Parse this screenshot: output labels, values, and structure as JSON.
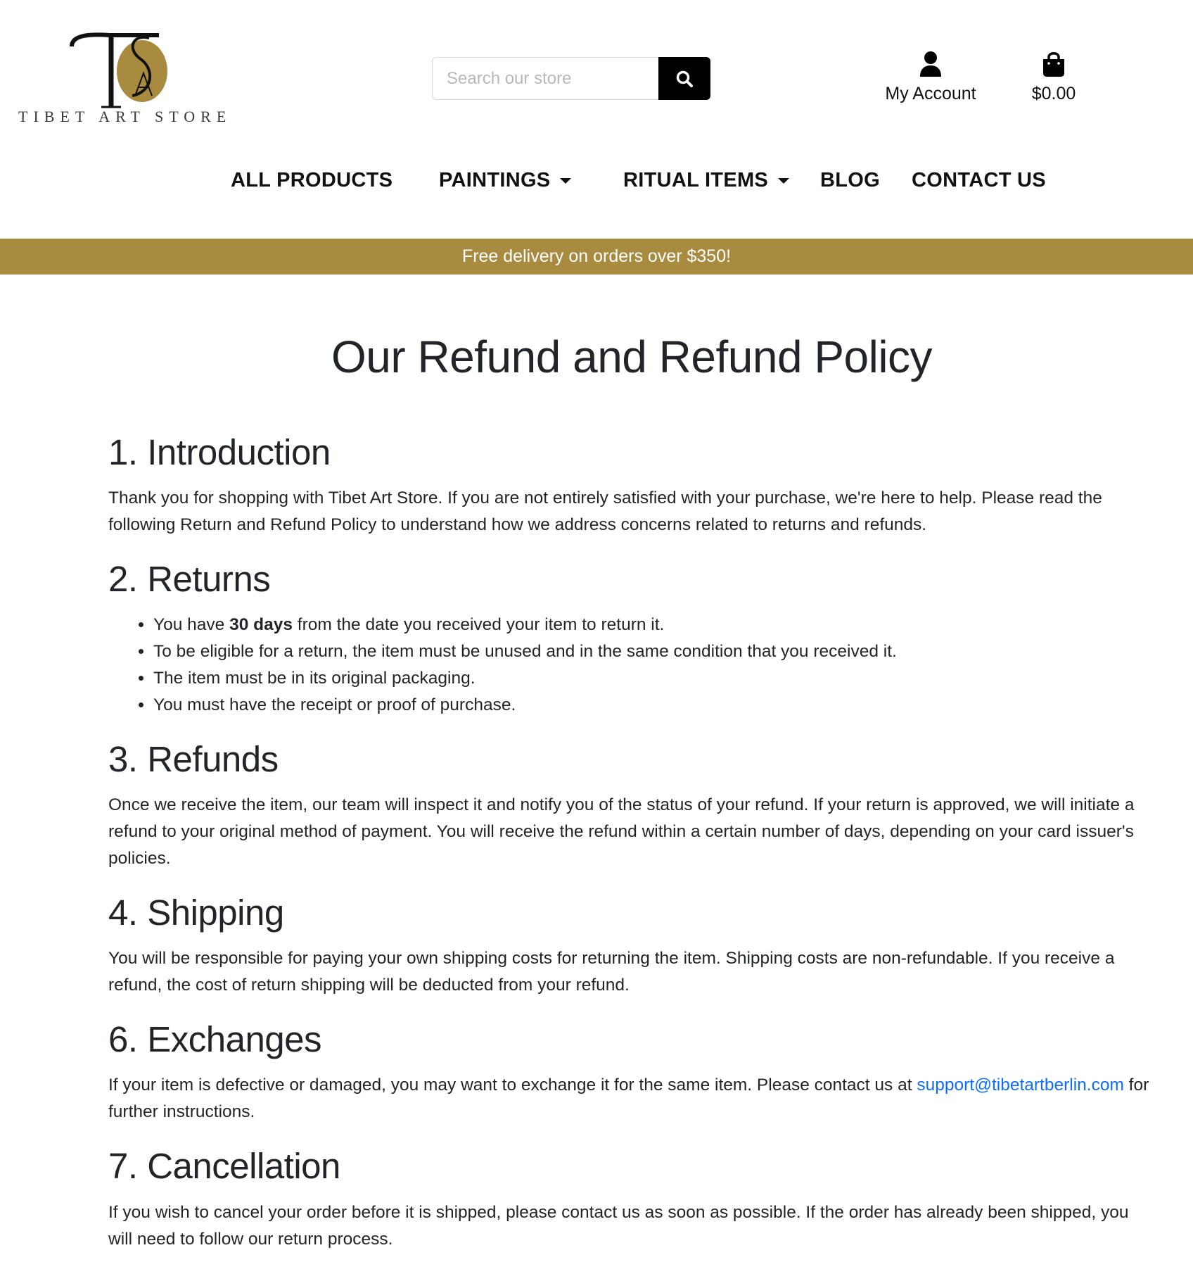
{
  "header": {
    "logo_text": "TIBET ART STORE",
    "search": {
      "placeholder": "Search our store",
      "value": ""
    },
    "account_label": "My Account",
    "cart_total": "$0.00"
  },
  "nav": {
    "items": [
      {
        "label": "ALL PRODUCTS",
        "has_dropdown": false
      },
      {
        "label": "PAINTINGS",
        "has_dropdown": true
      },
      {
        "label": "RITUAL ITEMS",
        "has_dropdown": true
      },
      {
        "label": "BLOG",
        "has_dropdown": false
      },
      {
        "label": "CONTACT US",
        "has_dropdown": false
      }
    ]
  },
  "banner": {
    "text": "Free delivery on orders over $350!"
  },
  "page": {
    "title": "Our Refund and Refund Policy",
    "sections": {
      "intro": {
        "heading": "1. Introduction",
        "text": "Thank you for shopping with Tibet Art Store. If you are not entirely satisfied with your purchase, we're here to help. Please read the following Return and Refund Policy to understand how we address concerns related to returns and refunds."
      },
      "returns": {
        "heading": "2. Returns",
        "item1_pre": "You have ",
        "item1_bold": "30 days",
        "item1_post": " from the date you received your item to return it.",
        "item2": "To be eligible for a return, the item must be unused and in the same condition that you received it.",
        "item3": "The item must be in its original packaging.",
        "item4": "You must have the receipt or proof of purchase."
      },
      "refunds": {
        "heading": "3. Refunds",
        "text": "Once we receive the item, our team will inspect it and notify you of the status of your refund. If your return is approved, we will initiate a refund to your original method of payment. You will receive the refund within a certain number of days, depending on your card issuer's policies."
      },
      "shipping": {
        "heading": "4. Shipping",
        "text": "You will be responsible for paying your own shipping costs for returning the item. Shipping costs are non-refundable. If you receive a refund, the cost of return shipping will be deducted from your refund."
      },
      "exchanges": {
        "heading": "6. Exchanges",
        "text_pre": "If your item is defective or damaged, you may want to exchange it for the same item. Please contact us at ",
        "email": "support@tibetartberlin.com",
        "text_post": " for further instructions."
      },
      "cancellation": {
        "heading": "7. Cancellation",
        "text": "If you wish to cancel your order before it is shipped, please contact us as soon as possible. If the order has already been shipped, you will need to follow our return process."
      }
    }
  },
  "colors": {
    "banner_bg": "#a88b3f",
    "logo_gold": "#a88b3f",
    "link": "#0d6efd",
    "text": "#212529"
  }
}
